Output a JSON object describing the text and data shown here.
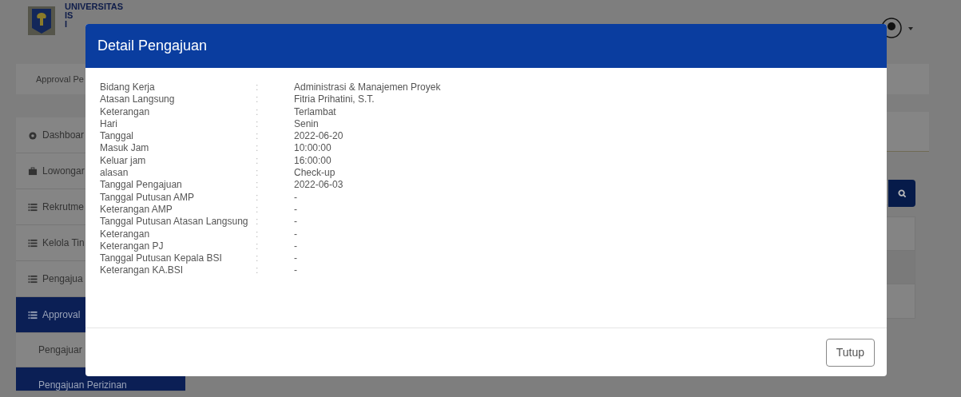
{
  "header": {
    "brand_lines": [
      "UNIVERSITAS",
      "IS",
      "I"
    ]
  },
  "breadcrumb": "Approval Pe",
  "sidebar": {
    "items": [
      {
        "label": "Dashboar",
        "selected": false
      },
      {
        "label": "Lowongar",
        "selected": false
      },
      {
        "label": "Rekrutme",
        "selected": false
      },
      {
        "label": "Kelola Tin",
        "selected": false
      },
      {
        "label": "Pengajua",
        "selected": false
      },
      {
        "label": "Approval",
        "selected": true,
        "children": [
          {
            "label": "Pengajuar",
            "selected": false
          },
          {
            "label": "Pengajuan Perizinan",
            "selected": true
          }
        ]
      }
    ]
  },
  "modal": {
    "title": "Detail Pengajuan",
    "fields": [
      {
        "label": "Bidang Kerja",
        "separator": ":",
        "value": "Administrasi & Manajemen Proyek"
      },
      {
        "label": "Atasan Langsung",
        "separator": ":",
        "value": "Fitria Prihatini, S.T."
      },
      {
        "label": "Keterangan",
        "separator": ":",
        "value": "Terlambat"
      },
      {
        "label": "Hari",
        "separator": ":",
        "value": "Senin"
      },
      {
        "label": "Tanggal",
        "separator": ":",
        "value": "2022-06-20"
      },
      {
        "label": "Masuk Jam",
        "separator": ":",
        "value": "10:00:00"
      },
      {
        "label": "Keluar jam",
        "separator": ":",
        "value": "16:00:00"
      },
      {
        "label": "alasan",
        "separator": ":",
        "value": "Check-up"
      },
      {
        "label": "Tanggal Pengajuan",
        "separator": ":",
        "value": "2022-06-03"
      },
      {
        "label": "Tanggal Putusan AMP",
        "separator": ":",
        "value": "-"
      },
      {
        "label": "Keterangan AMP",
        "separator": ":",
        "value": "-"
      },
      {
        "label": "Tanggal Putusan Atasan Langsung",
        "separator": ":",
        "value": "-"
      },
      {
        "label": "Keterangan",
        "separator": ":",
        "value": "-"
      },
      {
        "label": "Keterangan PJ",
        "separator": ":",
        "value": "-"
      },
      {
        "label": "Tanggal Putusan Kepala BSI",
        "separator": ":",
        "value": "-"
      },
      {
        "label": "Keterangan KA.BSI",
        "separator": ":",
        "value": "-"
      }
    ],
    "close_button": "Tutup"
  }
}
